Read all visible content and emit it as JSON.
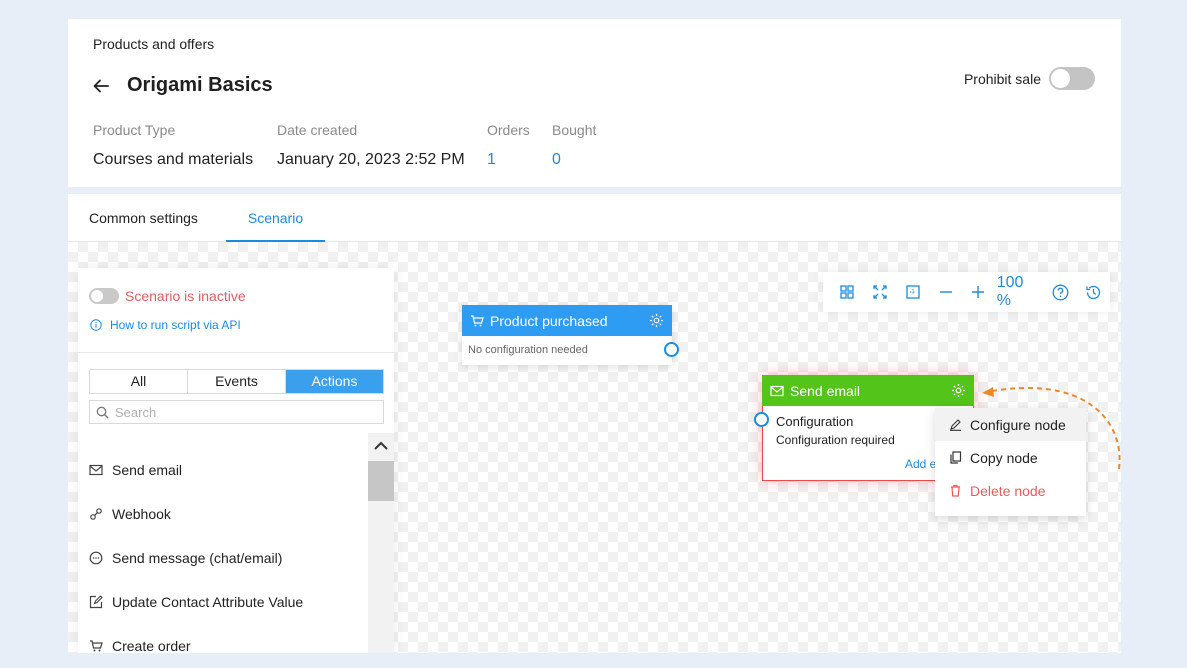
{
  "header": {
    "breadcrumb": "Products and offers",
    "title": "Origami Basics",
    "prohibit_label": "Prohibit sale",
    "meta": [
      {
        "label": "Product Type",
        "value": "Courses and materials"
      },
      {
        "label": "Date created",
        "value": "January 20, 2023 2:52 PM"
      },
      {
        "label": "Orders",
        "value": "1"
      },
      {
        "label": "Bought",
        "value": "0"
      }
    ]
  },
  "tabs": [
    {
      "label": "Common settings",
      "active": false
    },
    {
      "label": "Scenario",
      "active": true
    }
  ],
  "panel": {
    "status": "Scenario is inactive",
    "api_link": "How to run script via API",
    "filters": [
      "All",
      "Events",
      "Actions"
    ],
    "active_filter": "Actions",
    "search_placeholder": "Search",
    "actions": [
      {
        "label": "Send email",
        "icon": "mail-icon"
      },
      {
        "label": "Webhook",
        "icon": "webhook-icon"
      },
      {
        "label": "Send message (chat/email)",
        "icon": "chat-icon"
      },
      {
        "label": "Update Contact Attribute Value",
        "icon": "edit-icon"
      },
      {
        "label": "Create order",
        "icon": "cart-icon"
      }
    ]
  },
  "toolbar": {
    "zoom": "100 %",
    "icons": [
      "grid-icon",
      "fit-icon",
      "frame-icon",
      "zoom-out-icon",
      "zoom-in-icon",
      "help-icon",
      "history-icon"
    ]
  },
  "nodes": {
    "product": {
      "title": "Product purchased",
      "body": "No configuration needed",
      "color": "#2f9cf3"
    },
    "email": {
      "title": "Send email",
      "config_label": "Configuration",
      "config_status": "Configuration required",
      "add_link": "Add e",
      "color": "#52c41a",
      "border": "#f04848"
    }
  },
  "context_menu": {
    "items": [
      {
        "label": "Configure node",
        "icon": "pencil-icon"
      },
      {
        "label": "Copy node",
        "icon": "copy-icon"
      },
      {
        "label": "Delete node",
        "icon": "trash-icon"
      }
    ]
  },
  "colors": {
    "accent": "#1a8ce0",
    "danger": "#e35d5d",
    "arrow": "#e88a2c"
  }
}
